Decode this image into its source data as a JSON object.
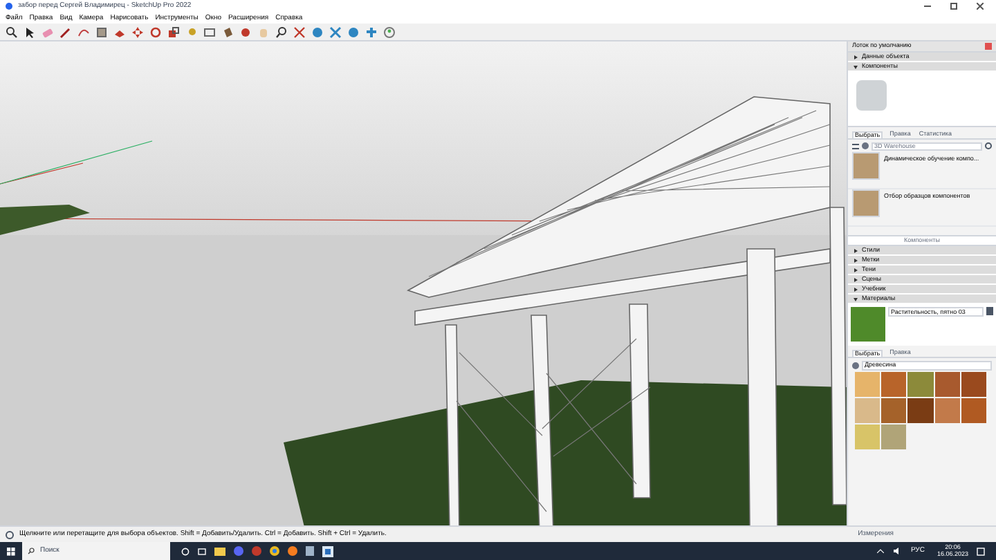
{
  "window": {
    "title": "забор перед Сергей Владимирец - SketchUp Pro 2022"
  },
  "menu": [
    "Файл",
    "Правка",
    "Вид",
    "Камера",
    "Нарисовать",
    "Инструменты",
    "Окно",
    "Расширения",
    "Справка"
  ],
  "tray": {
    "title": "Лоток по умолчанию",
    "sections_top": [
      {
        "label": "Данные объекта",
        "expanded": false
      },
      {
        "label": "Компоненты",
        "expanded": true
      }
    ],
    "components": {
      "tabs": [
        {
          "label": "Выбрать",
          "selected": true
        },
        {
          "label": "Правка",
          "selected": false
        },
        {
          "label": "Статистика",
          "selected": false
        }
      ],
      "search": {
        "placeholder": "3D Warehouse"
      },
      "items": [
        "Динамическое обучение компо...",
        "Отбор образцов компонентов"
      ],
      "footer": "Компоненты"
    },
    "sections": [
      {
        "label": "Стили",
        "expanded": false
      },
      {
        "label": "Метки",
        "expanded": false
      },
      {
        "label": "Тени",
        "expanded": false
      },
      {
        "label": "Сцены",
        "expanded": false
      },
      {
        "label": "Учебник",
        "expanded": false
      },
      {
        "label": "Материалы",
        "expanded": true
      }
    ],
    "materials": {
      "name": "Растительность, пятно 03",
      "tabs": [
        {
          "label": "Выбрать",
          "selected": true
        },
        {
          "label": "Правка",
          "selected": false
        }
      ],
      "library": "Древесина",
      "swatches": [
        {
          "color": "#e6b46a"
        },
        {
          "color": "#b8642a"
        },
        {
          "color": "#8c8a3a"
        },
        {
          "color": "#a85a2e"
        },
        {
          "color": "#9a4a1e"
        },
        {
          "color": "#d9b98a"
        },
        {
          "color": "#a5622a"
        },
        {
          "color": "#7a3c14"
        },
        {
          "color": "#c27a4a"
        },
        {
          "color": "#b05a22"
        },
        {
          "color": "#d8c468"
        },
        {
          "color": "#b0a478"
        }
      ]
    }
  },
  "status_bar": {
    "hint": "Щелкните или перетащите для выбора объектов. Shift = Добавить/Удалить. Ctrl = Добавить. Shift + Ctrl = Удалить.",
    "measure_label": "Измерения"
  },
  "taskbar": {
    "search": {
      "placeholder": "Поиск"
    },
    "language": "РУС",
    "time": "20:06",
    "date": "16.06.2023"
  }
}
